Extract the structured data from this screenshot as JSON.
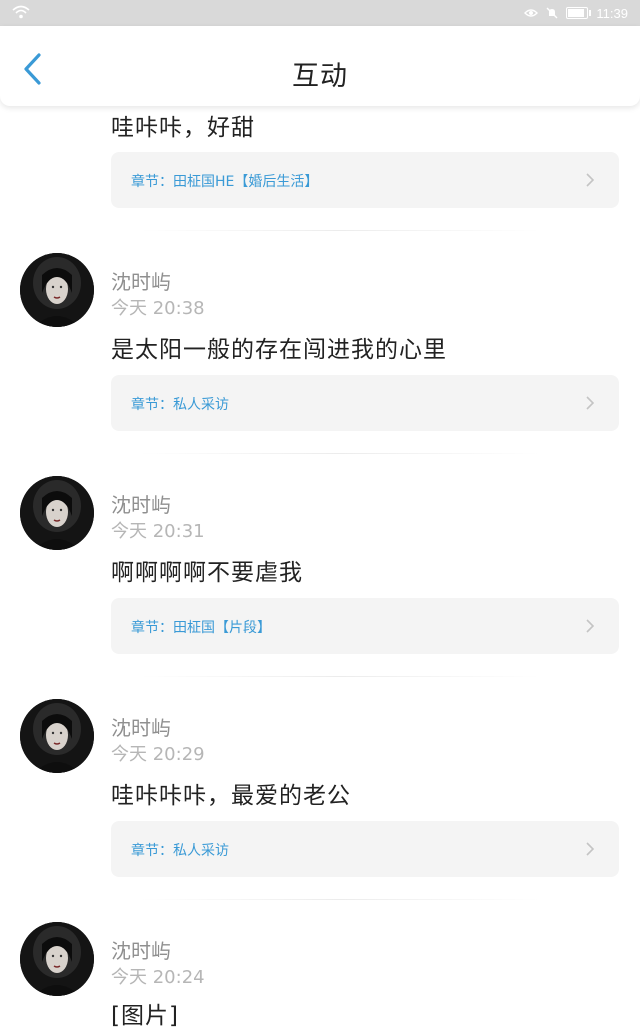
{
  "status_bar": {
    "time": "11:39"
  },
  "header": {
    "title": "互动",
    "back_icon": "chevron-left-icon",
    "accent": "#3a9ad6"
  },
  "partial_item": {
    "text": "哇咔咔，好甜",
    "chapter": "章节：田柾国HE【婚后生活】"
  },
  "comments": [
    {
      "name": "沈时屿",
      "time": "今天 20:38",
      "text": "是太阳一般的存在闯进我的心里",
      "chapter": "章节：私人采访"
    },
    {
      "name": "沈时屿",
      "time": "今天 20:31",
      "text": "啊啊啊啊不要虐我",
      "chapter": "章节：田柾国【片段】"
    },
    {
      "name": "沈时屿",
      "time": "今天 20:29",
      "text": "哇咔咔咔，最爱的老公",
      "chapter": "章节：私人采访"
    },
    {
      "name": "沈时屿",
      "time": "今天 20:24",
      "text": "[图片]"
    }
  ]
}
